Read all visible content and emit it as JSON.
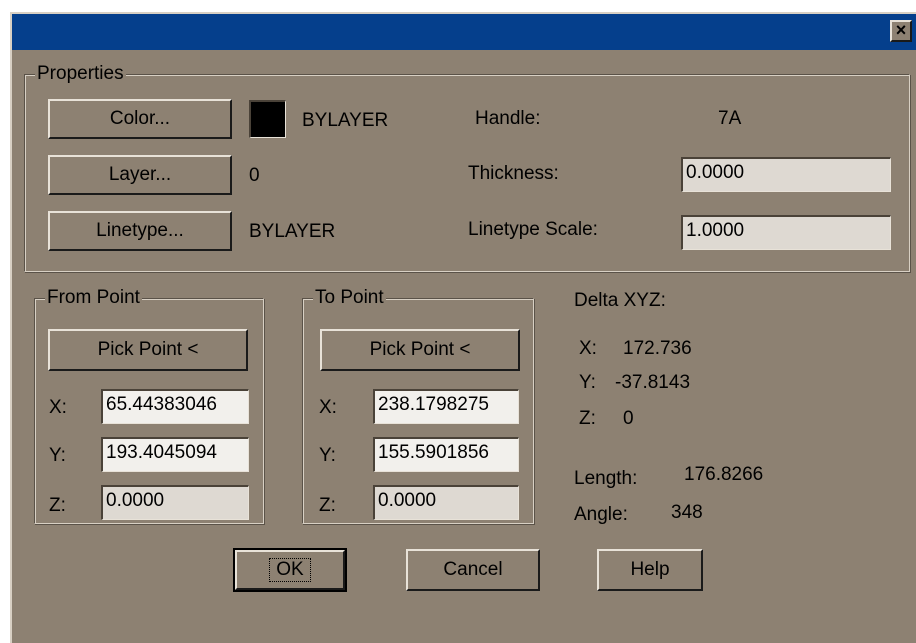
{
  "window": {
    "close_label": "×"
  },
  "properties": {
    "legend": "Properties",
    "color_button": "Color...",
    "color_value": "BYLAYER",
    "layer_button": "Layer...",
    "layer_value": "0",
    "linetype_button": "Linetype...",
    "linetype_value": "BYLAYER",
    "handle_label": "Handle:",
    "handle_value": "7A",
    "thickness_label": "Thickness:",
    "thickness_value": "0.0000",
    "linetype_scale_label": "Linetype Scale:",
    "linetype_scale_value": "1.0000"
  },
  "from_point": {
    "legend": "From Point",
    "pick_button": "Pick Point <",
    "x_label": "X:",
    "x_value": "65.44383046",
    "y_label": "Y:",
    "y_value": "193.4045094",
    "z_label": "Z:",
    "z_value": "0.0000"
  },
  "to_point": {
    "legend": "To Point",
    "pick_button": "Pick Point <",
    "x_label": "X:",
    "x_value": "238.1798275",
    "y_label": "Y:",
    "y_value": "155.5901856",
    "z_label": "Z:",
    "z_value": "0.0000"
  },
  "delta": {
    "title": "Delta XYZ:",
    "x_label": "X:",
    "x_value": "172.736",
    "y_label": "Y:",
    "y_value": "-37.8143",
    "z_label": "Z:",
    "z_value": "0",
    "length_label": "Length:",
    "length_value": "176.8266",
    "angle_label": "Angle:",
    "angle_value": "348"
  },
  "buttons": {
    "ok": "OK",
    "cancel": "Cancel",
    "help": "Help"
  },
  "colors": {
    "titlebar": "#053f8c",
    "dialog_bg": "#8d8172",
    "swatch": "#000000"
  }
}
